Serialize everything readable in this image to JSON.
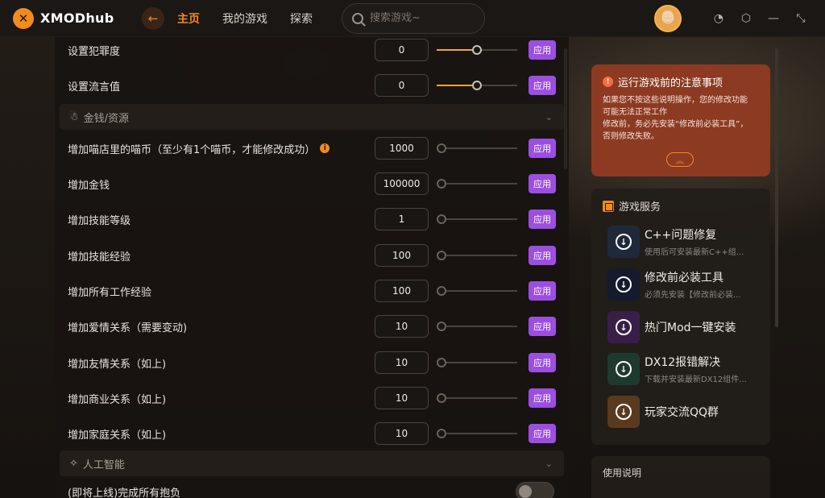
{
  "header": {
    "logo_mark": "✕",
    "logo_text": "XMODhub",
    "back_icon": "arrow-left-icon",
    "nav": [
      {
        "label": "主页",
        "active": true
      },
      {
        "label": "我的游戏",
        "active": false
      },
      {
        "label": "探索",
        "active": false
      }
    ],
    "search_placeholder": "搜索游戏~",
    "window_controls": [
      "bell-icon",
      "settings-icon",
      "minimize-icon",
      "shrink-icon"
    ]
  },
  "rows": [
    {
      "label": "设置犯罪度",
      "value": "0",
      "fill": 0.5,
      "apply": "应用"
    },
    {
      "label": "设置流言值",
      "value": "0",
      "fill": 0.5,
      "apply": "应用"
    }
  ],
  "sections": {
    "money": {
      "icon": "money-bag-icon",
      "title": "金钱/资源",
      "chevron": "⌄"
    },
    "ai": {
      "icon": "ai-icon",
      "title": "人工智能",
      "chevron": "⌄"
    }
  },
  "money_rows": [
    {
      "label": "增加喵店里的喵币（至少有1个喵币，才能修改成功）",
      "info": true,
      "value": "1000",
      "fill": 0.03,
      "apply": "应用"
    },
    {
      "label": "增加金钱",
      "value": "100000",
      "fill": 0,
      "apply": "应用"
    },
    {
      "label": "增加技能等级",
      "value": "1",
      "fill": 0,
      "apply": "应用"
    },
    {
      "label": "增加技能经验",
      "value": "100",
      "fill": 0,
      "apply": "应用"
    },
    {
      "label": "增加所有工作经验",
      "value": "100",
      "fill": 0,
      "apply": "应用"
    },
    {
      "label": "增加爱情关系（需要变动)",
      "value": "10",
      "fill": 0,
      "apply": "应用"
    },
    {
      "label": "增加友情关系（如上)",
      "value": "10",
      "fill": 0,
      "apply": "应用"
    },
    {
      "label": "增加商业关系（如上)",
      "value": "10",
      "fill": 0,
      "apply": "应用"
    },
    {
      "label": "增加家庭关系（如上)",
      "value": "10",
      "fill": 0,
      "apply": "应用"
    }
  ],
  "ai_rows": [
    {
      "label": "(即将上线)完成所有抱负",
      "toggle": false
    }
  ],
  "notice": {
    "icon": "!",
    "title": "运行游戏前的注意事项",
    "lines": [
      "如果您不按这些说明操作，您的修改功能",
      "可能无法正常工作",
      "修改前，务必先安装“修改前必装工具”，",
      "否则修改失败。"
    ],
    "collapse": "︽"
  },
  "services": {
    "title": "游戏服务",
    "items": [
      {
        "title": "C++问题修复",
        "desc": "使用后可安装最新C++组...",
        "color": "#1e2a3a"
      },
      {
        "title": "修改前必装工具",
        "desc": "必须先安装【修改前必装...",
        "color": "#141b2c"
      },
      {
        "title": "热门Mod一键安装",
        "desc": "",
        "color": "#3a1e4a"
      },
      {
        "title": "DX12报错解决",
        "desc": "下载并安装最新DX12组件...",
        "color": "#1e3a2e"
      },
      {
        "title": "玩家交流QQ群",
        "desc": "",
        "color": "#5a3a1e"
      }
    ]
  },
  "usage": {
    "title": "使用说明"
  },
  "colors": {
    "accent": "#f28a1e",
    "apply": "#9b4fe0",
    "notice": "#8c3a22"
  }
}
